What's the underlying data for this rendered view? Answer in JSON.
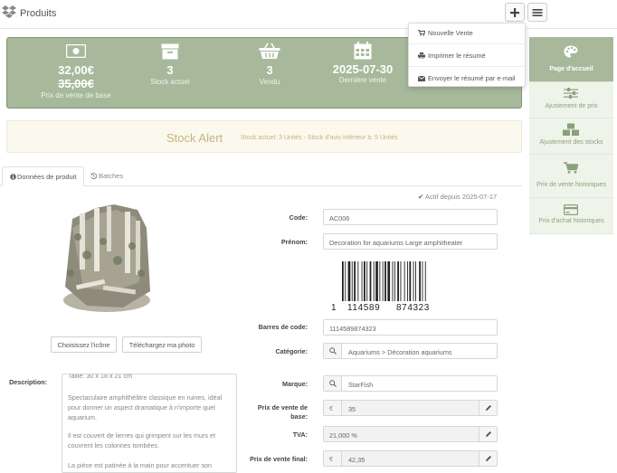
{
  "header": {
    "title": "Produits",
    "icons": {
      "brand": "dropbox-box-icon",
      "add": "plus-icon",
      "menu": "hamburger-icon"
    }
  },
  "dropdown": {
    "items": [
      {
        "label": "Nouvelle Vente",
        "icon": "cart-icon"
      },
      {
        "label": "Imprimer le résumé",
        "icon": "printer-icon"
      },
      {
        "label": "Envoyer le résumé par e-mail",
        "icon": "envelope-icon"
      }
    ]
  },
  "stats": {
    "price": {
      "value": "32,00€",
      "old_value": "35,00€",
      "label": "Prix de vente de base",
      "icon": "banknote-icon"
    },
    "stock": {
      "value": "3",
      "label": "Stock actuel",
      "icon": "archive-box-icon"
    },
    "sold": {
      "value": "3",
      "label": "Vendu",
      "icon": "basket-icon"
    },
    "last_sale": {
      "value": "2025-07-30",
      "label": "Dernière vente",
      "icon": "calendar-icon"
    }
  },
  "sidebar": {
    "items": [
      {
        "label": "Page d'accueil",
        "icon": "palette-icon",
        "active": true
      },
      {
        "label": "Ajustement de prix",
        "icon": "sliders-icon",
        "active": false
      },
      {
        "label": "Ajustement des stocks",
        "icon": "cubes-icon",
        "active": false
      },
      {
        "label": "Prix de vente historiques",
        "icon": "cart-icon",
        "active": false
      },
      {
        "label": "Prix d'achat historiques",
        "icon": "credit-card-icon",
        "active": false
      }
    ]
  },
  "alert": {
    "title": "Stock Alert",
    "detail": "Stock actuel: 3 Unités  -  Stock d'avis inférieur à: 5 Unités"
  },
  "tabs": [
    {
      "label": "Données de produit",
      "icon": "info-circle-icon",
      "active": true
    },
    {
      "label": "Batches",
      "icon": "history-icon",
      "active": false
    }
  ],
  "status": {
    "active_since": "Actif depuis 2025-07-17"
  },
  "image_buttons": {
    "choose_icon": "Choisissez l'icône",
    "upload_photo": "Téléchargez ma photo"
  },
  "form": {
    "code": {
      "label": "Code:",
      "value": "AC006"
    },
    "name": {
      "label": "Prénom:",
      "value": "Decoration for aquariums Large amphitheater"
    },
    "barcode_image": {
      "digits_left": "1",
      "digits_mid": "114589",
      "digits_right": "874323"
    },
    "barcode": {
      "label": "Barres de code:",
      "value": "1114589874323"
    },
    "category": {
      "label": "Catégorie:",
      "value": "Aquariums  > Décoration aquariums"
    },
    "brand": {
      "label": "Marque:",
      "value": "StarFish"
    },
    "base_price": {
      "label_line1": "Prix de vente de",
      "label_line2": "base:",
      "currency": "€",
      "value": "35"
    },
    "vat": {
      "label": "TVA:",
      "value": "21,000 %"
    },
    "final_price": {
      "label": "Prix de vente final:",
      "currency": "€",
      "value": "42,35"
    },
    "description": {
      "label": "Description:",
      "lines": [
        "Taille: 30 x 18 x 21 cm",
        "Spectaculaire amphithéâtre classique en ruines, idéal pour donner un aspect dramatique à n'importe quel aquarium.",
        "Il est couvert de lierres qui grimpent sur les murs et couvrent les colonnes tombées.",
        "La pièce est patinée à la main pour accentuer son"
      ]
    }
  }
}
